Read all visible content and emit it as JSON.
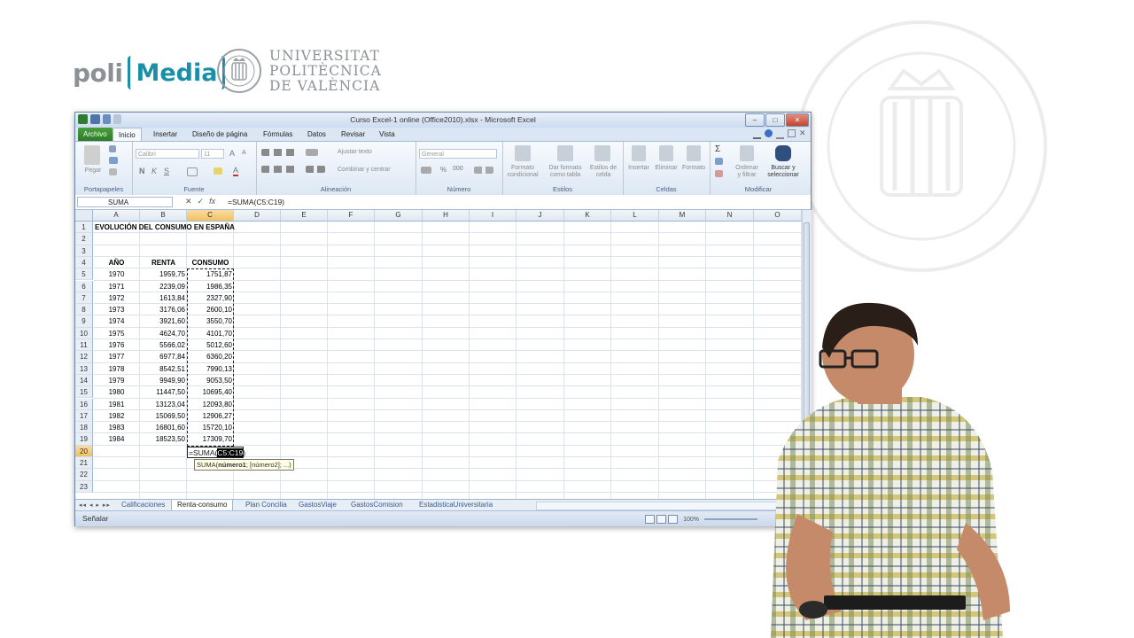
{
  "branding": {
    "poli": "poli",
    "media": "Media",
    "university_line1": "UNIVERSITAT",
    "university_line2": "POLITÈCNICA",
    "university_line3": "DE VALÈNCIA"
  },
  "window": {
    "title": "Curso Excel-1 online (Office2010).xlsx - Microsoft Excel",
    "controls": {
      "minimize": "–",
      "maximize": "□",
      "close": "✕"
    }
  },
  "ribbon_tabs": [
    "Archivo",
    "Inicio",
    "Insertar",
    "Diseño de página",
    "Fórmulas",
    "Datos",
    "Revisar",
    "Vista"
  ],
  "active_tab": "Inicio",
  "ribbon": {
    "portapapeles": {
      "label": "Portapapeles",
      "paste": "Pegar"
    },
    "fuente": {
      "label": "Fuente",
      "font": "Calibri",
      "size": "11",
      "bold": "N",
      "italic": "K",
      "underline": "S"
    },
    "alineacion": {
      "label": "Alineación",
      "wrap": "Ajustar texto",
      "merge": "Combinar y centrar"
    },
    "numero": {
      "label": "Número",
      "format": "General",
      "percent": "%",
      "thousands": "000"
    },
    "estilos": {
      "label": "Estilos",
      "cond_line1": "Formato",
      "cond_line2": "condicional",
      "table_line1": "Dar formato",
      "table_line2": "como tabla",
      "cell_line1": "Estilos de",
      "cell_line2": "celda"
    },
    "celdas": {
      "label": "Celdas",
      "insert": "Insertar",
      "delete": "Eliminar",
      "format": "Formato"
    },
    "modificar": {
      "label": "Modificar",
      "sort_line1": "Ordenar",
      "sort_line2": "y filtrar",
      "find_line1": "Buscar y",
      "find_line2": "seleccionar"
    }
  },
  "formula_bar": {
    "name_box": "SUMA",
    "cancel": "✕",
    "enter": "✓",
    "fx": "fx",
    "formula": "=SUMA(C5:C19)"
  },
  "columns": [
    "A",
    "B",
    "C",
    "D",
    "E",
    "F",
    "G",
    "H",
    "I",
    "J",
    "K",
    "L",
    "M",
    "N",
    "O"
  ],
  "selected_column": "C",
  "rows": [
    "1",
    "2",
    "3",
    "4",
    "5",
    "6",
    "7",
    "8",
    "9",
    "10",
    "11",
    "12",
    "13",
    "14",
    "15",
    "16",
    "17",
    "18",
    "19",
    "20",
    "21",
    "22",
    "23"
  ],
  "selected_row": "20",
  "sheet": {
    "title": "EVOLUCIÓN DEL CONSUMO EN ESPAÑA",
    "headers": {
      "a": "AÑO",
      "b": "RENTA",
      "c": "CONSUMO"
    },
    "data": [
      [
        "1970",
        "1959,75",
        "1751,87"
      ],
      [
        "1971",
        "2239,09",
        "1986,35"
      ],
      [
        "1972",
        "1613,84",
        "2327,90"
      ],
      [
        "1973",
        "3176,06",
        "2600,10"
      ],
      [
        "1974",
        "3921,60",
        "3550,70"
      ],
      [
        "1975",
        "4624,70",
        "4101,70"
      ],
      [
        "1976",
        "5566,02",
        "5012,60"
      ],
      [
        "1977",
        "6977,84",
        "6360,20"
      ],
      [
        "1978",
        "8542,51",
        "7990,13"
      ],
      [
        "1979",
        "9949,90",
        "9053,50"
      ],
      [
        "1980",
        "11447,50",
        "10695,40"
      ],
      [
        "1981",
        "13123,04",
        "12093,80"
      ],
      [
        "1982",
        "15069,50",
        "12906,27"
      ],
      [
        "1983",
        "16801,60",
        "15720,10"
      ],
      [
        "1984",
        "18523,50",
        "17309,70"
      ]
    ],
    "edit_prefix": "=SUMA(",
    "edit_range": "C5:C19",
    "edit_suffix": ")",
    "tooltip_fn": "SUMA(",
    "tooltip_arg1": "número1",
    "tooltip_rest": "; [número2]; ...)"
  },
  "sheet_tabs": [
    "Calificaciones",
    "Renta-consumo",
    "Plan Concilia",
    "GastosViaje",
    "GastosComision",
    "EstadisticaUniversitaria"
  ],
  "active_sheet": "Renta-consumo",
  "status": {
    "mode": "Señalar",
    "zoom": "100%"
  }
}
